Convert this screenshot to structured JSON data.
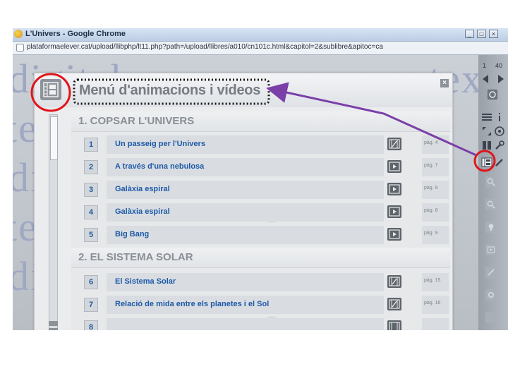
{
  "window": {
    "title": "L'Univers - Google Chrome",
    "url": "plataformaelever.cat/upload/llibphp/lt11.php?path=/upload/llibres/a010/cn101c.html&capitol=2&sublibre&apitoc=ca"
  },
  "watermark_words": [
    "digital",
    "text",
    "digital",
    "text",
    "digital",
    "text"
  ],
  "panel": {
    "title": "Menú d'animacions i vídeos",
    "close_label": "×"
  },
  "sections": [
    {
      "title": "1. COPSAR L’UNIVERS",
      "items": [
        {
          "num": "1",
          "title": "Un passeig per l'Univers",
          "type": "film-icon",
          "page": "pàg. 4"
        },
        {
          "num": "2",
          "title": "A través d'una nebulosa",
          "type": "play-icon",
          "page": "pàg. 7"
        },
        {
          "num": "3",
          "title": "Galàxia espiral",
          "type": "play-icon",
          "page": "pàg. 8"
        },
        {
          "num": "4",
          "title": "Galàxia espiral",
          "type": "play-icon",
          "page": "pàg. 8"
        },
        {
          "num": "5",
          "title": "Big Bang",
          "type": "play-icon",
          "page": "pàg. 9"
        }
      ]
    },
    {
      "title": "2. EL SISTEMA SOLAR",
      "items": [
        {
          "num": "6",
          "title": "El Sistema Solar",
          "type": "film-icon",
          "page": "pàg. 15"
        },
        {
          "num": "7",
          "title": "Relació de mida entre els planetes i el Sol",
          "type": "film-icon",
          "page": "pàg. 16"
        },
        {
          "num": "8",
          "title": "",
          "type": "film-icon",
          "page": ""
        }
      ]
    }
  ],
  "toolbar": {
    "page_current": "1",
    "page_total": "40"
  },
  "colors": {
    "highlight_circle": "#e0151b",
    "arrow": "#7b3fa8",
    "link_text": "#1d59a8"
  }
}
